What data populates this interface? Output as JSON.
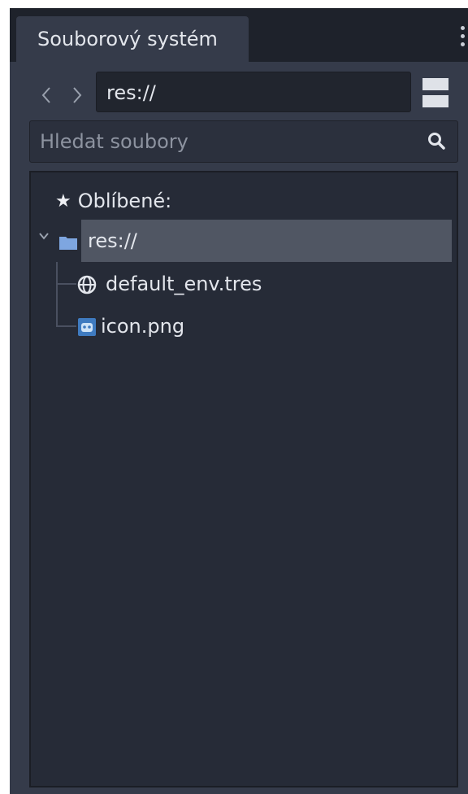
{
  "dock": {
    "tab_label": "Souborový systém"
  },
  "toolbar": {
    "back_icon": "chevron-left-icon",
    "forward_icon": "chevron-right-icon",
    "path_value": "res://",
    "layout_icon": "split-layout-icon"
  },
  "search": {
    "placeholder": "Hledat soubory",
    "icon": "search-icon"
  },
  "tree": {
    "favorites_label": "Oblíbené:",
    "root_label": "res://",
    "items": [
      {
        "label": "default_env.tres",
        "icon": "globe-icon"
      },
      {
        "label": "icon.png",
        "icon": "image-icon"
      }
    ]
  },
  "colors": {
    "dock_bg": "#2b3140",
    "panel_bg": "#353b4a",
    "tree_bg": "#262b37",
    "selection": "#505663",
    "folder": "#7ea6e0",
    "text": "#e3e6ec"
  }
}
